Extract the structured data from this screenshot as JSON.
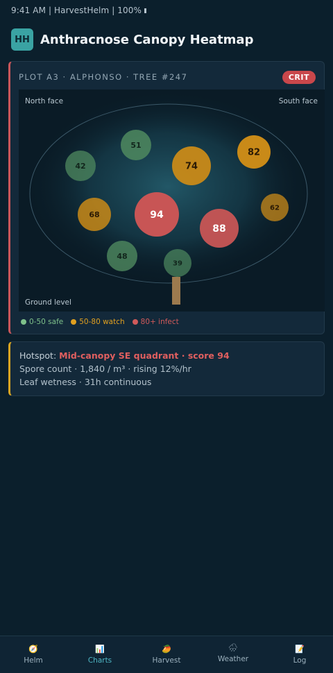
{
  "status": {
    "text": "9:41 AM | HarvestHelm | 100%"
  },
  "header": {
    "badge": "HH",
    "title": "Anthracnose Canopy Heatmap"
  },
  "heatmap": {
    "plot_label": "PLOT A3 · ALPHONSO · TREE #247",
    "badge": "CRIT",
    "labels": {
      "north": "North face",
      "south": "South face",
      "ground": "Ground level"
    },
    "zones": [
      {
        "score": 51,
        "level": "safe"
      },
      {
        "score": 42,
        "level": "safe"
      },
      {
        "score": 74,
        "level": "watch"
      },
      {
        "score": 82,
        "level": "watch"
      },
      {
        "score": 68,
        "level": "watch"
      },
      {
        "score": 94,
        "level": "infect"
      },
      {
        "score": 88,
        "level": "infect"
      },
      {
        "score": 62,
        "level": "watch"
      },
      {
        "score": 48,
        "level": "safe"
      },
      {
        "score": 39,
        "level": "safe"
      }
    ],
    "legend": [
      {
        "label": "0-50 safe",
        "color": "#7ec08a"
      },
      {
        "label": "50-80 watch",
        "color": "#e0a020"
      },
      {
        "label": "80+ infect",
        "color": "#d05a5a"
      }
    ],
    "colors": {
      "safe": "#4f8a5f",
      "watch": "#c98a18",
      "infect": "#c85555"
    }
  },
  "hotspot": {
    "prefix": "Hotspot: ",
    "value": "Mid-canopy SE quadrant · score 94",
    "spore": "Spore count · 1,840 / m³ · rising 12%/hr",
    "wetness": "Leaf wetness · 31h continuous"
  },
  "tabs": [
    {
      "label": "Helm",
      "icon": "compass-icon",
      "glyph": "🧭",
      "active": false
    },
    {
      "label": "Charts",
      "icon": "chart-icon",
      "glyph": "📊",
      "active": true
    },
    {
      "label": "Harvest",
      "icon": "mango-icon",
      "glyph": "🥭",
      "active": false
    },
    {
      "label": "Weather",
      "icon": "rain-cloud-icon",
      "glyph": "🌧",
      "active": false
    },
    {
      "label": "Log",
      "icon": "memo-icon",
      "glyph": "📝",
      "active": false
    }
  ]
}
